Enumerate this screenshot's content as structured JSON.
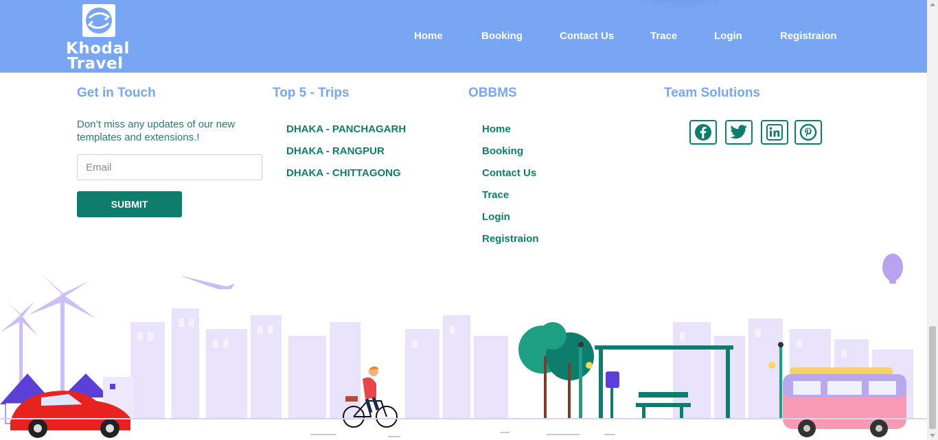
{
  "brand": {
    "logo_line1": "Khodal",
    "logo_line2": "Travel"
  },
  "nav": {
    "items": [
      {
        "label": "Home"
      },
      {
        "label": "Booking"
      },
      {
        "label": "Contact Us"
      },
      {
        "label": "Trace"
      },
      {
        "label": "Login"
      },
      {
        "label": "Registraion"
      }
    ]
  },
  "footer": {
    "contact": {
      "title": "Get in Touch",
      "description": "Don’t miss any updates of our new templates and extensions.!",
      "email_placeholder": "Email",
      "submit_label": "SUBMIT"
    },
    "trips": {
      "title": "Top 5 - Trips",
      "items": [
        "DHAKA - PANCHAGARH",
        "DHAKA - RANGPUR",
        "DHAKA - CHITTAGONG"
      ]
    },
    "obbms": {
      "title": "OBBMS",
      "items": [
        "Home",
        "Booking",
        "Contact Us",
        "Trace",
        "Login",
        "Registraion"
      ]
    },
    "team": {
      "title": "Team Solutions",
      "social": [
        "facebook-icon",
        "twitter-icon",
        "linkedin-icon",
        "pinterest-icon"
      ]
    }
  },
  "colors": {
    "navbar": "#78a6f3",
    "heading": "#78a6f3",
    "accent": "#0e7d6d",
    "city": "#e4dcfb"
  }
}
